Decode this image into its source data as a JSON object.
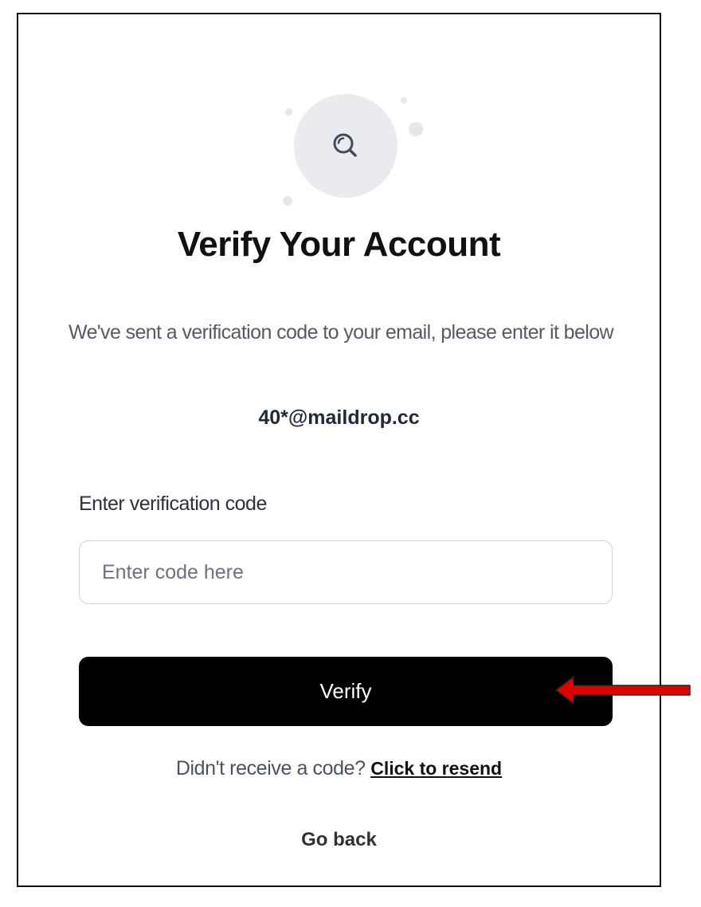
{
  "verify": {
    "title": "Verify Your Account",
    "subtitle": "We've sent a verification code to your email, please enter it below",
    "email": "40*@maildrop.cc",
    "field_label": "Enter verification code",
    "input_placeholder": "Enter code here",
    "input_value": "",
    "button_label": "Verify",
    "resend_prompt": "Didn't receive a code?",
    "resend_link": "Click to resend",
    "go_back": "Go back"
  },
  "icons": {
    "header_icon": "search-icon",
    "annotation": "red-arrow-left"
  },
  "colors": {
    "button_bg": "#000000",
    "icon_circle_bg": "#eaebee",
    "annotation_arrow": "#e00000"
  }
}
